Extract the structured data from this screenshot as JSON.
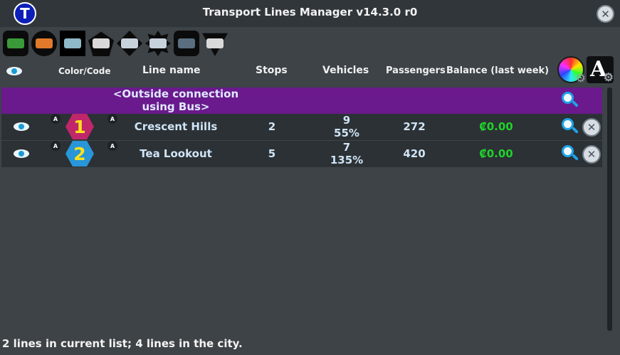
{
  "window": {
    "title": "Transport Lines Manager v14.3.0 r0",
    "logo_letter": "T"
  },
  "tabs": [
    {
      "name": "bus",
      "shape": "rect",
      "glyph_color": "#3a9a3a"
    },
    {
      "name": "trolleybus",
      "shape": "circle",
      "glyph_color": "#e07a2a"
    },
    {
      "name": "tram",
      "shape": "square",
      "glyph_color": "#8fb8c8",
      "selected": true
    },
    {
      "name": "airplane",
      "shape": "pent",
      "glyph_color": "#d9d9d9"
    },
    {
      "name": "ship",
      "shape": "diamond",
      "glyph_color": "#c8d2dc"
    },
    {
      "name": "cruise",
      "shape": "star",
      "glyph_color": "#c8d2dc"
    },
    {
      "name": "ferry",
      "shape": "rect",
      "glyph_color": "#5a6e80"
    },
    {
      "name": "blimp",
      "shape": "tri",
      "glyph_color": "#d9d9d9"
    }
  ],
  "headers": {
    "color_code": "Color/Code",
    "line_name": "Line name",
    "stops": "Stops",
    "vehicles": "Vehicles",
    "passengers": "Passengers",
    "balance": "Balance (last week)",
    "font_button_letter": "A"
  },
  "outside_connection": {
    "label_line1": "<Outside connection",
    "label_line2": "using Bus>"
  },
  "lines": [
    {
      "code": "1",
      "badge": "A",
      "code_color": "#c0276a",
      "name": "Crescent Hills",
      "stops": "2",
      "vehicles": "9",
      "vehicles_pct": "55%",
      "passengers": "272",
      "balance": "₡0.00"
    },
    {
      "code": "2",
      "badge": "A",
      "code_color": "#2896d8",
      "name": "Tea Lookout",
      "stops": "5",
      "vehicles": "7",
      "vehicles_pct": "135%",
      "passengers": "420",
      "balance": "₡0.00"
    }
  ],
  "footer": {
    "status": "2 lines in current list; 4 lines in the city."
  }
}
